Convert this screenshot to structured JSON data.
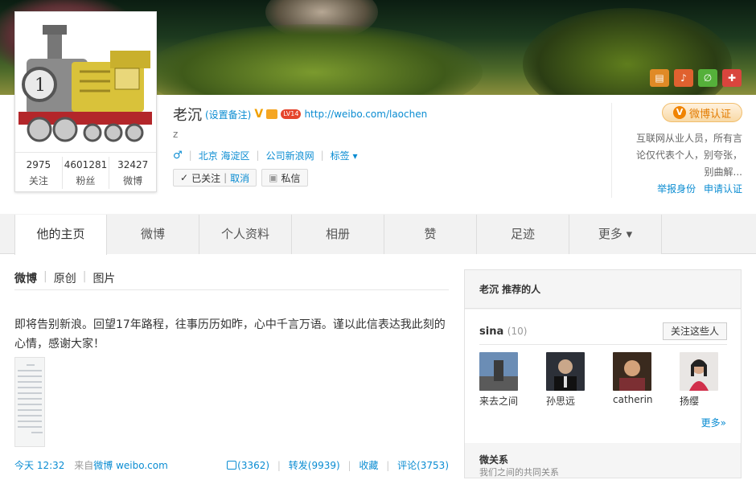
{
  "profile": {
    "name": "老沉",
    "remark_label": "(设置备注)",
    "url": "http://weibo.com/laochen",
    "intro": "z",
    "gender_icon": "♂",
    "location": "北京 海淀区",
    "company": "公司新浪网",
    "tags_label": "标签 ▾",
    "level": "LV14",
    "following_count": "2975",
    "following_label": "关注",
    "followers_count": "4601281",
    "followers_label": "粉丝",
    "posts_count": "32427",
    "posts_label": "微博",
    "followed_label": "已关注",
    "cancel_label": "取消",
    "message_label": "私信"
  },
  "verify": {
    "label": "微博认证",
    "description": "互联网从业人员，所有言论仅代表个人，别夸张，别曲解...",
    "report_label": "举报身份",
    "apply_label": "申请认证"
  },
  "tabs": [
    {
      "label": "他的主页"
    },
    {
      "label": "微博"
    },
    {
      "label": "个人资料"
    },
    {
      "label": "相册"
    },
    {
      "label": "赞"
    },
    {
      "label": "足迹"
    },
    {
      "label": "更多 ▾"
    }
  ],
  "feed": {
    "tab_weibo": "微博",
    "tab_original": "原创",
    "tab_pictures": "图片",
    "post_text": "即将告别新浪。回望17年路程，往事历历如昨，心中千言万语。谨以此信表达我此刻的心情，感谢大家！",
    "time": "今天 12:32",
    "source_prefix": "来自",
    "source": "微博 weibo.com",
    "likes": "(3362)",
    "reposts": "转发(9939)",
    "favorite": "收藏",
    "comments": "评论(3753)"
  },
  "recommend": {
    "title": "老沉 推荐的人",
    "group_name": "sina",
    "group_count": "(10)",
    "follow_all_label": "关注这些人",
    "people": [
      {
        "name": "来去之间"
      },
      {
        "name": "孙思远"
      },
      {
        "name": "catherin..."
      },
      {
        "name": "扬缨"
      }
    ],
    "more_label": "更多»",
    "relation_title": "微关系",
    "relation_sub": "我们之间的共同关系"
  },
  "colors": {
    "link": "#0a8cd2",
    "accent": "#e37b00"
  }
}
